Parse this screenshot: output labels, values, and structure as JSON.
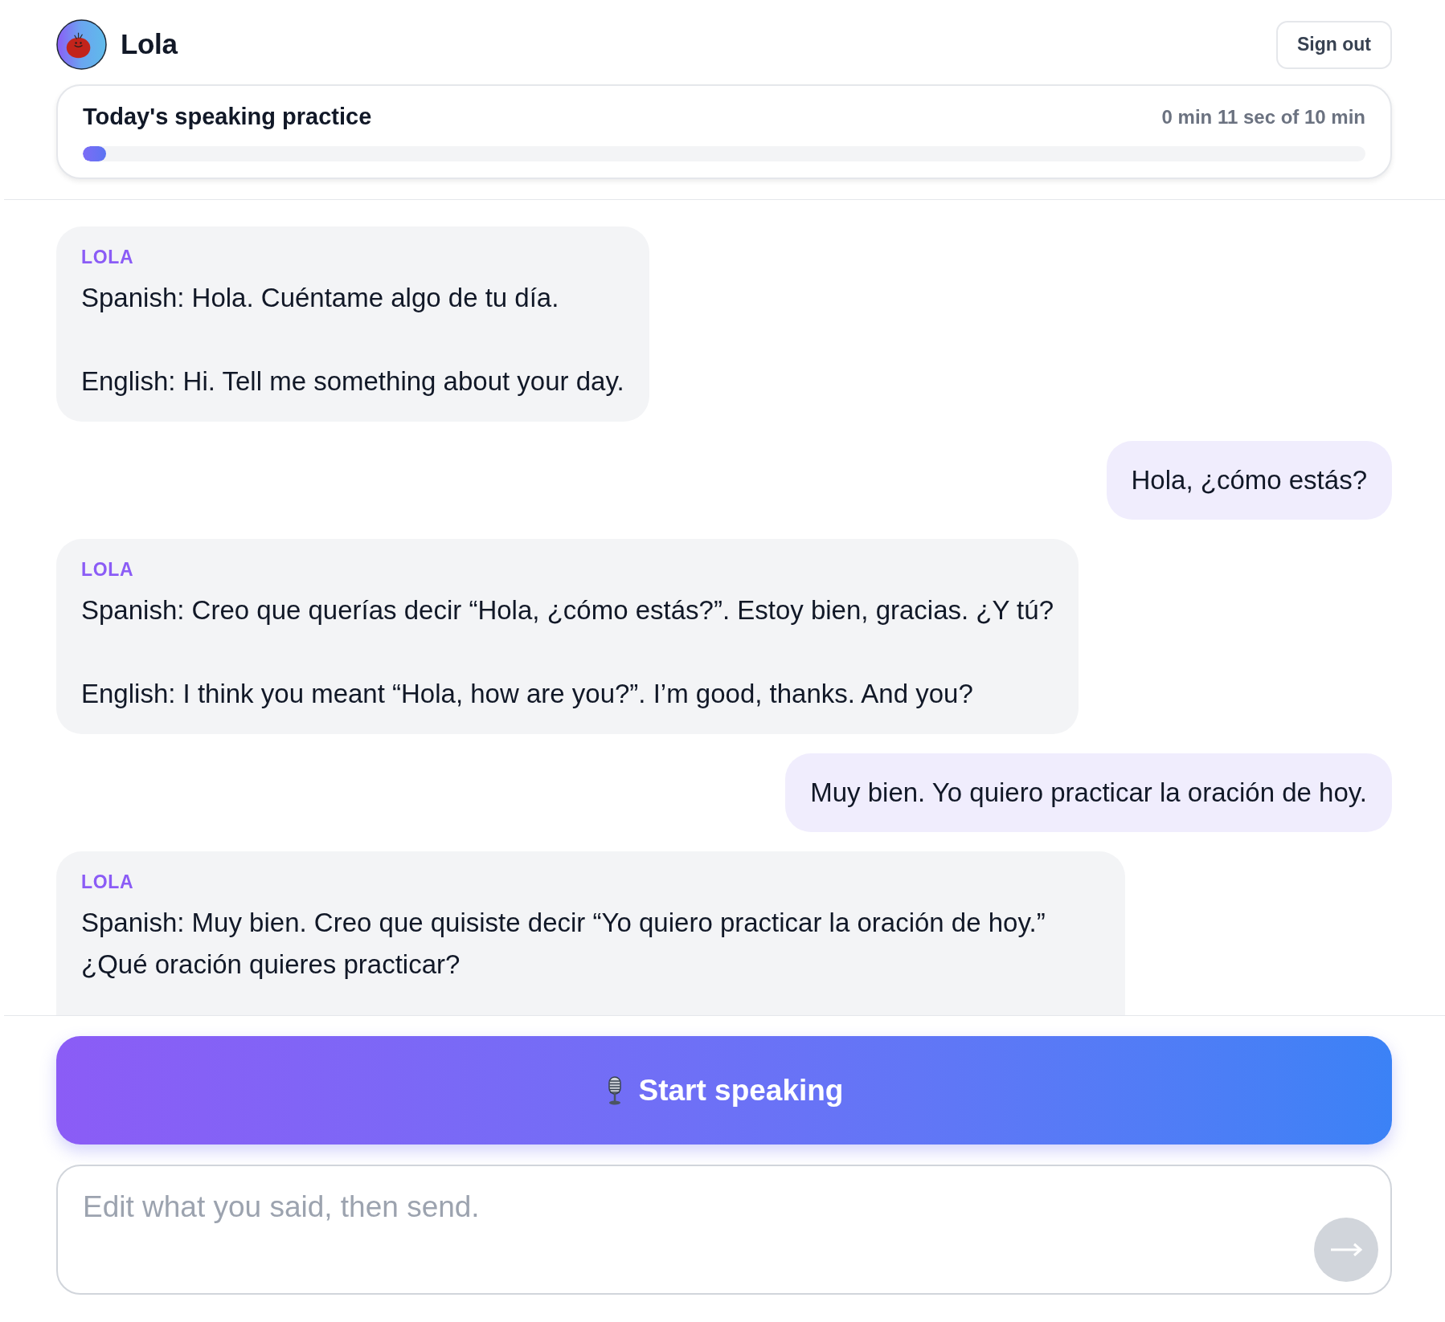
{
  "header": {
    "title": "Lola",
    "sign_out": "Sign out"
  },
  "practice": {
    "title": "Today's speaking practice",
    "time": "0 min 11 sec of 10 min",
    "level": 0.018
  },
  "messages": [
    {
      "kind": "tutor",
      "sender": "LOLA",
      "lines": [
        "Spanish: Hola. Cuéntame algo de tu día.",
        "English: Hi. Tell me something about your day."
      ],
      "cut_off": false
    },
    {
      "kind": "user",
      "lines": [
        "Hola, ¿cómo estás?"
      ]
    },
    {
      "kind": "tutor",
      "sender": "LOLA",
      "lines": [
        "Spanish: Creo que querías decir “Hola, ¿cómo estás?”. Estoy bien, gracias. ¿Y tú?",
        "English: I think you meant “Hola, how are you?”. I’m good, thanks. And you?"
      ],
      "cut_off": false
    },
    {
      "kind": "user",
      "lines": [
        "Muy bien. Yo quiero practicar la oración de hoy."
      ]
    },
    {
      "kind": "tutor",
      "sender": "LOLA",
      "lines": [
        "Spanish: Muy bien. Creo que quisiste decir “Yo quiero practicar la oración de hoy.” ¿Qué oración quieres practicar?"
      ],
      "cut_off": true
    }
  ],
  "speak_button": {
    "label": "Start speaking"
  },
  "composer": {
    "placeholder": "Edit what you said, then send.",
    "send_button": {
      "disabled": true
    }
  }
}
